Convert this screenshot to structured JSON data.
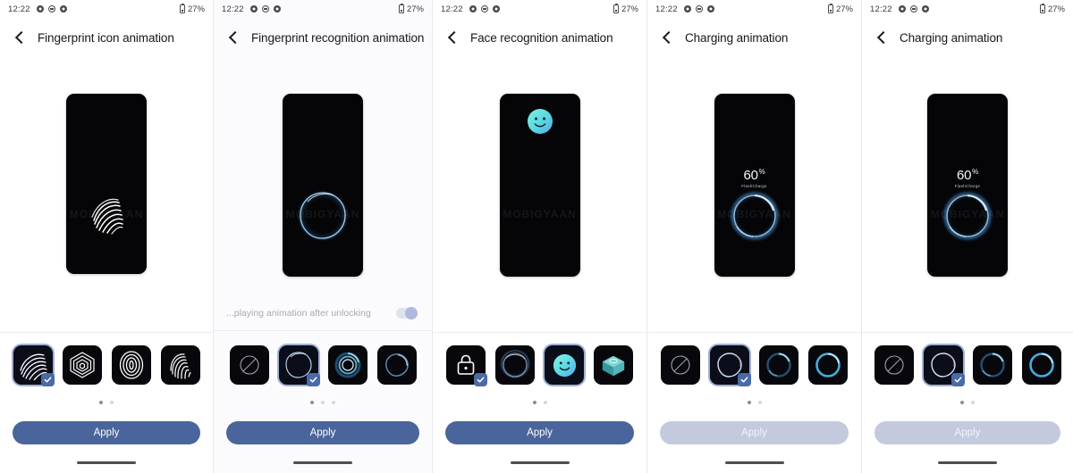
{
  "meta": {
    "watermark": "MOBIGYAAN"
  },
  "status_bar": {
    "time": "12:22",
    "battery_percent": "27%",
    "icons": [
      "gear-icon",
      "do-not-disturb-icon",
      "gear-icon"
    ]
  },
  "panels": [
    {
      "id": "fingerprint-icon-animation",
      "title": "Fingerprint icon animation",
      "preview": {
        "type": "fingerprint-swirl",
        "watermark": "MOBIGYAAN"
      },
      "has_toggle": false,
      "thumbnails": [
        {
          "name": "swirl-lines-thumb",
          "selected": true,
          "checked": true
        },
        {
          "name": "hex-layers-thumb",
          "selected": false,
          "checked": false
        },
        {
          "name": "oval-ridges-thumb",
          "selected": false,
          "checked": false
        },
        {
          "name": "fingerprint-classic-thumb",
          "selected": false,
          "checked": false
        }
      ],
      "dots": {
        "count": 2,
        "active": 0
      },
      "apply": {
        "label": "Apply",
        "enabled": true
      }
    },
    {
      "id": "fingerprint-recognition-animation",
      "title": "Fingerprint recognition animation",
      "preview": {
        "type": "glow-ring",
        "watermark": "MOBIGYAAN"
      },
      "has_toggle": true,
      "toggle": {
        "label": "...playing animation after unlocking",
        "state": "on"
      },
      "thumbnails": [
        {
          "name": "none-slash-thumb",
          "selected": false,
          "checked": false
        },
        {
          "name": "thin-ring-thumb",
          "selected": true,
          "checked": true
        },
        {
          "name": "swirl-ring-thumb",
          "selected": false,
          "checked": false
        },
        {
          "name": "sketch-ring-thumb",
          "selected": false,
          "checked": false
        }
      ],
      "dots": {
        "count": 3,
        "active": 0
      },
      "apply": {
        "label": "Apply",
        "enabled": true
      }
    },
    {
      "id": "face-recognition-animation",
      "title": "Face recognition animation",
      "preview": {
        "type": "smiley-face",
        "watermark": "MOBIGYAAN"
      },
      "has_toggle": false,
      "thumbnails": [
        {
          "name": "padlock-thumb",
          "selected": false,
          "checked": true
        },
        {
          "name": "dark-ring-thumb",
          "selected": false,
          "checked": false
        },
        {
          "name": "smiley-thumb",
          "selected": true,
          "checked": false
        },
        {
          "name": "cube-thumb",
          "selected": false,
          "checked": false
        }
      ],
      "dots": {
        "count": 2,
        "active": 0
      },
      "apply": {
        "label": "Apply",
        "enabled": true
      }
    },
    {
      "id": "charging-animation-a",
      "title": "Charging animation",
      "preview": {
        "type": "charging-ring",
        "percent": "60",
        "percent_symbol": "%",
        "subtitle": "FlashCharge",
        "watermark": "MOBIGYAAN"
      },
      "has_toggle": false,
      "thumbnails": [
        {
          "name": "none-slash-thumb",
          "selected": false,
          "checked": false
        },
        {
          "name": "sketch-ring-thumb",
          "selected": true,
          "checked": true
        },
        {
          "name": "dual-ring-thumb",
          "selected": false,
          "checked": false
        },
        {
          "name": "bright-ring-thumb",
          "selected": false,
          "checked": false
        }
      ],
      "dots": {
        "count": 2,
        "active": 0
      },
      "apply": {
        "label": "Apply",
        "enabled": false
      }
    },
    {
      "id": "charging-animation-b",
      "title": "Charging animation",
      "preview": {
        "type": "charging-ring",
        "percent": "60",
        "percent_symbol": "%",
        "subtitle": "FlashCharge",
        "watermark": "MOBIGYAAN"
      },
      "has_toggle": false,
      "thumbnails": [
        {
          "name": "none-slash-thumb",
          "selected": false,
          "checked": false
        },
        {
          "name": "sketch-ring-thumb",
          "selected": true,
          "checked": true
        },
        {
          "name": "dual-ring-thumb",
          "selected": false,
          "checked": false
        },
        {
          "name": "bright-ring-thumb",
          "selected": false,
          "checked": false
        }
      ],
      "dots": {
        "count": 2,
        "active": 0
      },
      "apply": {
        "label": "Apply",
        "enabled": false
      }
    }
  ],
  "colors": {
    "apply_enabled": "#4a659b",
    "apply_disabled": "#c3cadd",
    "selection_border": "#9fb0d6",
    "check_badge": "#4a6aa8",
    "accent_cyan": "#5fd9dd",
    "ring_blue": "#7fb6e8"
  }
}
